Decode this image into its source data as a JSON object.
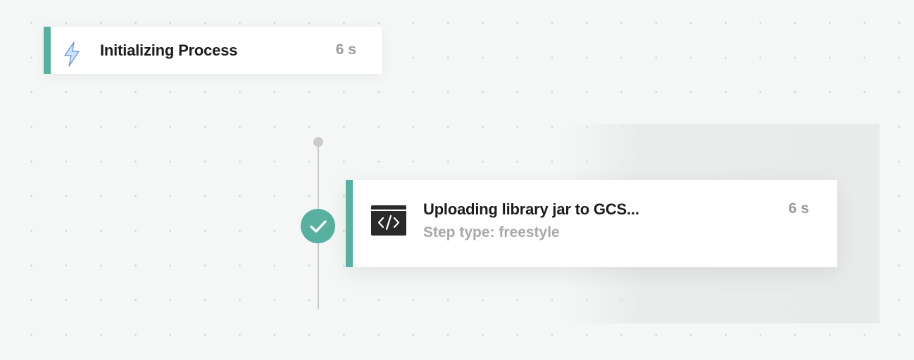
{
  "colors": {
    "accent": "#58b0a0",
    "background": "#f4f7f6",
    "title_text": "#1c1c1c",
    "muted_text": "#9a9a9a",
    "lightning_fill": "#cfe2ff",
    "lightning_stroke": "#5b8fd8",
    "step_icon_bg": "#2a2a2a"
  },
  "initializing_step": {
    "title": "Initializing Process",
    "duration": "6 s",
    "icon": "lightning-icon"
  },
  "workflow_step": {
    "title": "Uploading library jar to GCS...",
    "subtitle": "Step type: freestyle",
    "duration": "6 s",
    "icon": "code-terminal-icon",
    "status": "success",
    "status_icon": "checkmark-icon"
  }
}
